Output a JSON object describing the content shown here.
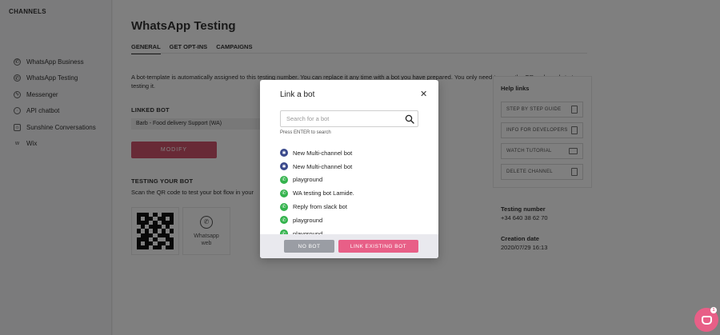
{
  "sidebar": {
    "title": "CHANNELS",
    "items": [
      {
        "label": "WhatsApp Business",
        "icon": "whatsapp-icon"
      },
      {
        "label": "WhatsApp Testing",
        "icon": "whatsapp-icon"
      },
      {
        "label": "Messenger",
        "icon": "messenger-icon"
      },
      {
        "label": "API chatbot",
        "icon": "api-icon"
      },
      {
        "label": "Sunshine Conversations",
        "icon": "sunshine-icon"
      },
      {
        "label": "Wix",
        "icon": "wix-icon"
      }
    ]
  },
  "main": {
    "title": "WhatsApp Testing",
    "tabs": [
      {
        "label": "GENERAL",
        "active": true
      },
      {
        "label": "GET OPT-INS",
        "active": false
      },
      {
        "label": "CAMPAIGNS",
        "active": false
      }
    ],
    "intro": "A bot-template is automatically assigned to this testing number. You can replace it any time with a bot you have prepared. You only need to scan the QR code and start testing it.",
    "linked_bot_label": "LINKED BOT",
    "linked_bot_value": "Barb - Food delivery Support (WA)",
    "modify_button": "MODIFY",
    "testing_label": "TESTING YOUR BOT",
    "scan_text": "Scan the QR code to test your bot flow in your",
    "whatsapp_web_label": "Whatsapp web"
  },
  "help": {
    "title": "Help links",
    "items": [
      {
        "label": "STEP BY STEP GUIDE",
        "icon": "document-icon"
      },
      {
        "label": "INFO FOR DEVELOPERS",
        "icon": "document-icon"
      },
      {
        "label": "WATCH TUTORIAL",
        "icon": "video-icon"
      },
      {
        "label": "DELETE CHANNEL",
        "icon": "trash-icon"
      }
    ],
    "testing_number_label": "Testing number",
    "testing_number_value": "+34 640 38 62 70",
    "creation_date_label": "Creation date",
    "creation_date_value": "2020/07/29 16:13"
  },
  "modal": {
    "title": "Link a bot",
    "close_icon": "close-icon",
    "search_placeholder": "Search for a bot",
    "search_hint": "Press ENTER to search",
    "bots": [
      {
        "name": "New Multi-channel bot",
        "icon": "multichannel-icon"
      },
      {
        "name": "New Multi-channel bot",
        "icon": "multichannel-icon"
      },
      {
        "name": "playground",
        "icon": "whatsapp-icon"
      },
      {
        "name": "WA testing bot Lamide.",
        "icon": "whatsapp-icon"
      },
      {
        "name": "Reply from slack bot",
        "icon": "whatsapp-icon"
      },
      {
        "name": "playground",
        "icon": "whatsapp-icon"
      },
      {
        "name": "playground",
        "icon": "whatsapp-icon"
      }
    ],
    "no_bot_button": "NO BOT",
    "link_button": "LINK EXISTING BOT"
  },
  "chat": {
    "badge": "1"
  },
  "colors": {
    "accent": "#e85f87",
    "overlay": "#000000",
    "whatsapp": "#34b34d",
    "multichannel": "#3b4a8c"
  }
}
